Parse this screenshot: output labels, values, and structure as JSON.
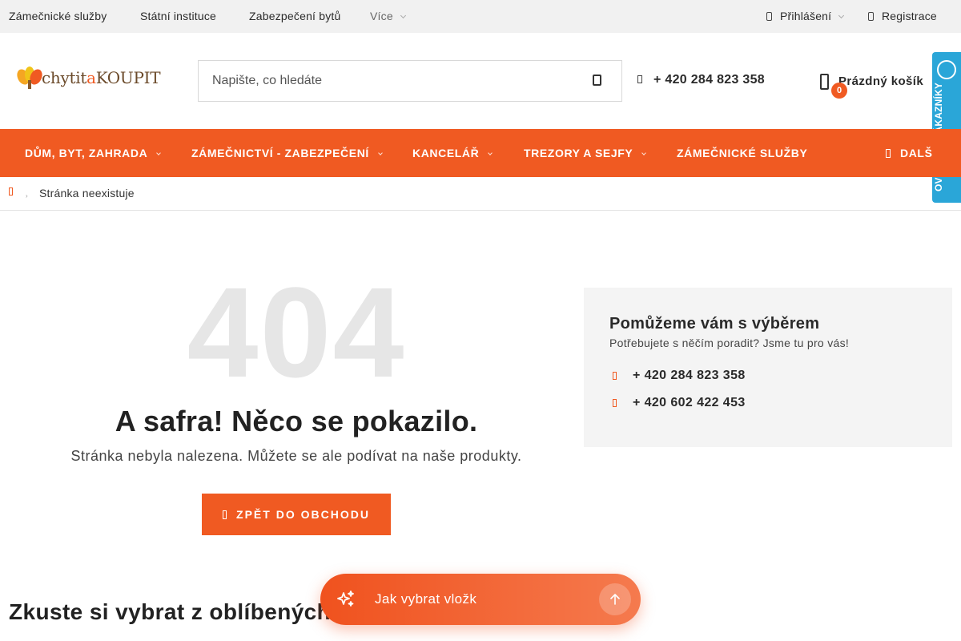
{
  "topbar": {
    "links": [
      "Zámečnické služby",
      "Státní instituce",
      "Zabezpečení bytů"
    ],
    "more_label": "Více",
    "login_label": "Přihlášení",
    "register_label": "Registrace"
  },
  "header": {
    "logo": {
      "part1": "chytit",
      "part2": "a",
      "part3": "KOUPIT"
    },
    "search_placeholder": "Napište, co hledáte",
    "phone": "+ 420 284 823 358",
    "cart_count": "0",
    "cart_label": "Prázdný košík",
    "verified_badge": "OVĚŘENO ZÁKAZNÍKY"
  },
  "nav": {
    "items": [
      "DŮM, BYT, ZAHRADA",
      "ZÁMEČNICTVÍ - ZABEZPEČENÍ",
      "KANCELÁŘ",
      "TREZORY A SEJFY",
      "ZÁMEČNICKÉ SLUŽBY"
    ],
    "more_label": "DALŠ"
  },
  "breadcrumb": {
    "current": "Stránka neexistuje"
  },
  "error": {
    "code": "404",
    "title": "A safra! Něco se pokazilo.",
    "subtitle": "Stránka nebyla nalezena. Můžete se ale podívat na naše produkty.",
    "button_label": "ZPĚT DO OBCHODU"
  },
  "help": {
    "title": "Pomůžeme vám s výběrem",
    "subtitle": "Potřebujete s něčím poradit? Jsme tu pro vás!",
    "phones": [
      "+ 420 284 823 358",
      "+ 420 602 422 453"
    ]
  },
  "favorites_heading": "Zkuste si vybrat z oblíbených",
  "assistant": {
    "prompt": "Jak vybrat vložk"
  },
  "colors": {
    "accent": "#f05a22",
    "badge": "#2aa6d8",
    "topbar_bg": "#f1f1f1",
    "help_bg": "#f4f4f4"
  }
}
